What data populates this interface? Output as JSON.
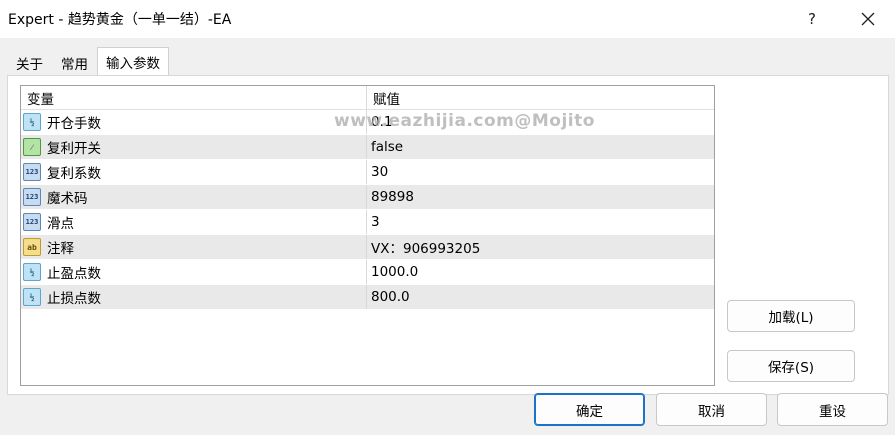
{
  "window": {
    "title": "Expert - 趋势黄金（一单一结）-EA",
    "help_label": "?"
  },
  "tabs": [
    {
      "label": "关于",
      "active": false
    },
    {
      "label": "常用",
      "active": false
    },
    {
      "label": "输入参数",
      "active": true
    }
  ],
  "grid": {
    "headers": {
      "variable": "变量",
      "value": "赋值"
    },
    "rows": [
      {
        "type_icon": "double-type-icon",
        "icon_text": "½",
        "name": "开仓手数",
        "value": "0.1"
      },
      {
        "type_icon": "bool-type-icon",
        "icon_text": "⁄",
        "name": "复利开关",
        "value": "false"
      },
      {
        "type_icon": "int-type-icon",
        "icon_text": "123",
        "name": "复利系数",
        "value": "30"
      },
      {
        "type_icon": "int-type-icon",
        "icon_text": "123",
        "name": "魔术码",
        "value": "89898"
      },
      {
        "type_icon": "int-type-icon",
        "icon_text": "123",
        "name": "滑点",
        "value": "3"
      },
      {
        "type_icon": "string-type-icon",
        "icon_text": "ab",
        "name": "注释",
        "value": "VX：906993205"
      },
      {
        "type_icon": "double-type-icon",
        "icon_text": "½",
        "name": "止盈点数",
        "value": "1000.0"
      },
      {
        "type_icon": "double-type-icon",
        "icon_text": "½",
        "name": "止损点数",
        "value": "800.0"
      }
    ]
  },
  "watermark": "www.eazhijia.com@Mojito",
  "buttons": {
    "load": "加载(L)",
    "save": "保存(S)",
    "ok": "确定",
    "cancel": "取消",
    "reset": "重设"
  },
  "colors": {
    "accent": "#1a73c8",
    "row_alt": "#e9e9e9",
    "dialog_bg": "#f0f0f0"
  }
}
